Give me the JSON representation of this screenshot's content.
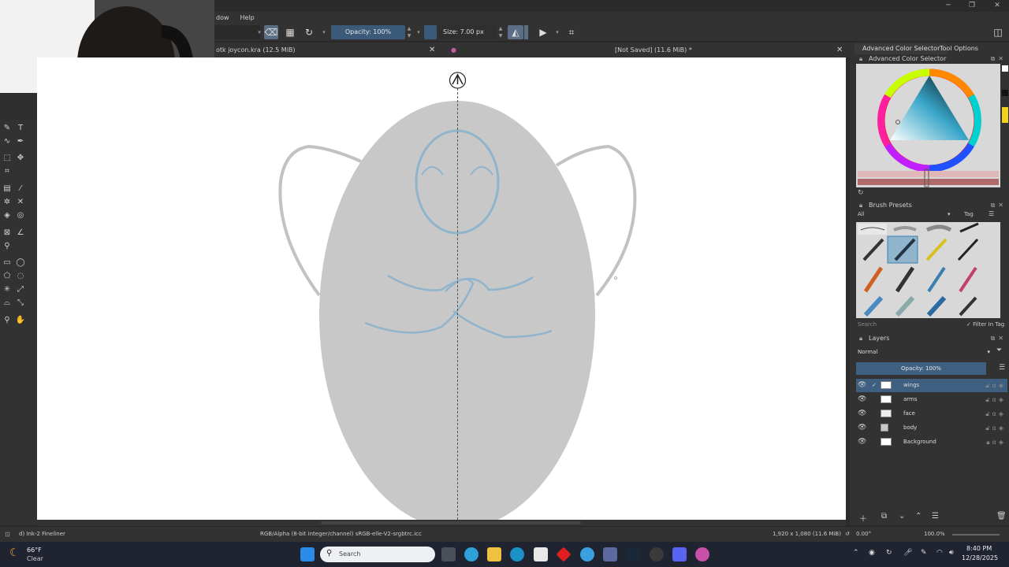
{
  "menu": {
    "items": [
      "dow",
      "Help"
    ]
  },
  "toolbar": {
    "opacity_label": "Opacity: 100%",
    "size_label": "Size: 7.00 px"
  },
  "tabs": [
    {
      "label": "otk joycon.kra (12.5 MiB)"
    },
    {
      "label": "[Not Saved]  (11.6 MiB) *"
    }
  ],
  "dock": {
    "color_tabs": [
      "Advanced Color Selector",
      "Tool Options"
    ],
    "color_panel_title": "Advanced Color Selector",
    "brush_panel_title": "Brush Presets",
    "brush_filter_value": "All",
    "brush_tag_label": "Tag",
    "brush_search_placeholder": "Search",
    "filter_in_tag_label": "Filter In Tag",
    "layers_title": "Layers",
    "blend_mode": "Normal",
    "layer_opacity": "Opacity:  100%",
    "layers": [
      {
        "name": "wings",
        "selected": true
      },
      {
        "name": "arms",
        "selected": false
      },
      {
        "name": "face",
        "selected": false
      },
      {
        "name": "body",
        "selected": false
      },
      {
        "name": "Background",
        "selected": false
      }
    ]
  },
  "status": {
    "brush_name": "d) Ink-2 Fineliner",
    "color_space": "RGB/Alpha (8-bit integer/channel)  sRGB-elle-V2-srgbtrc.icc",
    "dimensions": "1,920 x 1,080 (11.6 MiB)",
    "rotation": "0.00°",
    "zoom": "100.0%"
  },
  "taskbar": {
    "weather_temp": "66°F",
    "weather_desc": "Clear",
    "search_placeholder": "Search",
    "time": "8:40 PM",
    "date": "12/28/2025"
  },
  "colors": {
    "selection_blue": "#3f5f80",
    "sketch_blue": "#8fb4cc",
    "body_gray": "#c8c8c8"
  }
}
